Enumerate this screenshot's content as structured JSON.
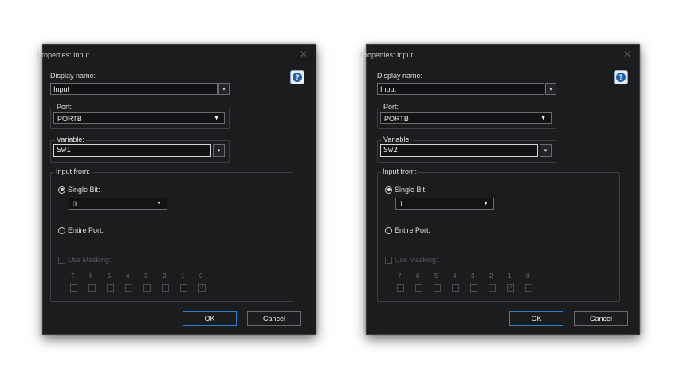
{
  "dialogs": [
    {
      "title": "Properties: Input",
      "close_glyph": "✕",
      "help_glyph": "?",
      "display_name_label": "Display name:",
      "display_name_value": "Input",
      "port_label": "Port:",
      "port_value": "PORTB",
      "variable_label": "Variable:",
      "variable_value": "Sw1",
      "input_from_label": "Input from:",
      "single_bit_label": "Single Bit:",
      "single_bit_value": "0",
      "entire_port_label": "Entire Port:",
      "use_masking_label": "Use Masking:",
      "bits": [
        "7",
        "6",
        "5",
        "4",
        "3",
        "2",
        "1",
        "0"
      ],
      "checked_bit": "0",
      "ok_label": "OK",
      "cancel_label": "Cancel"
    },
    {
      "title": "Properties: Input",
      "close_glyph": "✕",
      "help_glyph": "?",
      "display_name_label": "Display name:",
      "display_name_value": "Input",
      "port_label": "Port:",
      "port_value": "PORTB",
      "variable_label": "Variable:",
      "variable_value": "Sw2",
      "input_from_label": "Input from:",
      "single_bit_label": "Single Bit:",
      "single_bit_value": "1",
      "entire_port_label": "Entire Port:",
      "use_masking_label": "Use Masking:",
      "bits": [
        "7",
        "6",
        "5",
        "4",
        "3",
        "2",
        "1",
        "0"
      ],
      "checked_bit": "1",
      "ok_label": "OK",
      "cancel_label": "Cancel"
    }
  ],
  "icons": {
    "close": "close-icon",
    "help": "help-icon",
    "dropdown": "chevron-down-icon"
  },
  "colors": {
    "dialog_bg": "#1b1c1e",
    "primary_button_border": "#2e7fd0",
    "help_icon": "#1f5fb3"
  }
}
